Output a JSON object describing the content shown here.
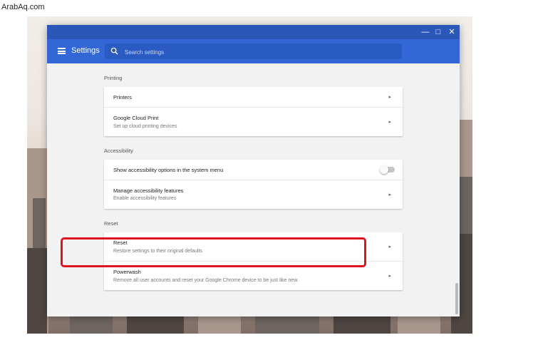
{
  "watermark": "ArabAq.com",
  "window": {
    "controls": {
      "minimize": "—",
      "maximize": "□",
      "close": "✕"
    }
  },
  "header": {
    "title": "Settings",
    "search": {
      "placeholder": "Search settings",
      "value": ""
    },
    "menu_icon": "hamburger-menu-icon",
    "search_icon": "search-icon"
  },
  "sections": {
    "printing": {
      "title": "Printing",
      "rows": [
        {
          "label": "Printers",
          "sub": ""
        },
        {
          "label": "Google Cloud Print",
          "sub": "Set up cloud printing devices"
        }
      ]
    },
    "accessibility": {
      "title": "Accessibility",
      "rows": [
        {
          "label": "Show accessibility options in the system menu",
          "toggle": false
        },
        {
          "label": "Manage accessibility features",
          "sub": "Enable accessibility features"
        }
      ]
    },
    "reset": {
      "title": "Reset",
      "rows": [
        {
          "label": "Reset",
          "sub": "Restore settings to their original defaults"
        },
        {
          "label": "Powerwash",
          "sub": "Remove all user accounts and reset your Google Chrome device to be just like new."
        }
      ]
    }
  },
  "arrow_glyph": "▸",
  "colors": {
    "titlebar": "#2b58b8",
    "header": "#3367d6",
    "highlight": "#e0141f"
  }
}
